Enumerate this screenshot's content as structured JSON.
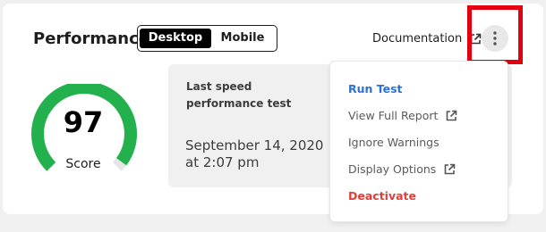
{
  "panel": {
    "title": "Performance"
  },
  "device_toggle": {
    "options": [
      "Desktop",
      "Mobile"
    ],
    "selected": "Desktop"
  },
  "header": {
    "documentation_label": "Documentation"
  },
  "score": {
    "value": "97",
    "label": "Score",
    "fraction": 0.97
  },
  "last_test": {
    "heading": "Last speed performance test",
    "date": "September 14, 2020 at 2:07 pm"
  },
  "menu": {
    "items": [
      {
        "label": "Run Test",
        "color": "#2e6fd9",
        "external": false
      },
      {
        "label": "View Full Report",
        "color": "#5a5a5a",
        "external": true
      },
      {
        "label": "Ignore Warnings",
        "color": "#5a5a5a",
        "external": false
      },
      {
        "label": "Display Options",
        "color": "#5a5a5a",
        "external": true
      },
      {
        "label": "Deactivate",
        "color": "#e0403a",
        "external": false
      }
    ]
  },
  "colors": {
    "gauge": "#23b14d",
    "gauge_track": "#e6e6e6",
    "highlight": "#e3000f"
  }
}
